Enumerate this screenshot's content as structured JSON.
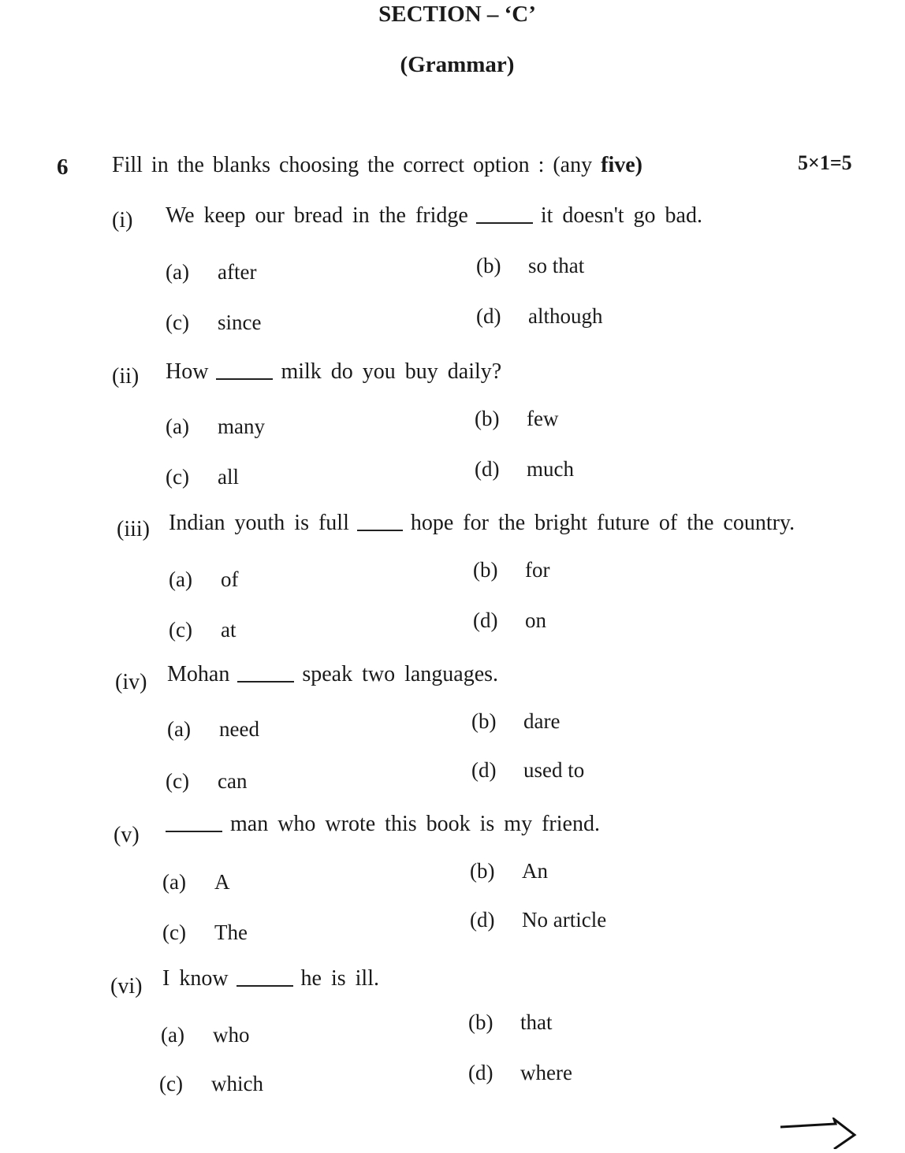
{
  "section": {
    "title": "SECTION – ‘C’",
    "subtitle": "(Grammar)"
  },
  "question": {
    "number": "6",
    "instruction": "Fill in the blanks choosing the correct option : (any",
    "instruction_bold": "five)",
    "marks": "5×1=5",
    "items": [
      {
        "label": "(i)",
        "before": "We keep our bread in the fridge",
        "after": "it doesn't go bad.",
        "options": [
          {
            "label": "(a)",
            "text": "after"
          },
          {
            "label": "(b)",
            "text": "so that"
          },
          {
            "label": "(c)",
            "text": "since"
          },
          {
            "label": "(d)",
            "text": "although"
          }
        ]
      },
      {
        "label": "(ii)",
        "before": "How",
        "after": "milk do you buy daily?",
        "options": [
          {
            "label": "(a)",
            "text": "many"
          },
          {
            "label": "(b)",
            "text": "few"
          },
          {
            "label": "(c)",
            "text": "all"
          },
          {
            "label": "(d)",
            "text": "much"
          }
        ]
      },
      {
        "label": "(iii)",
        "before": "Indian youth is full",
        "after": "hope for the bright future of the country.",
        "options": [
          {
            "label": "(a)",
            "text": "of"
          },
          {
            "label": "(b)",
            "text": "for"
          },
          {
            "label": "(c)",
            "text": "at"
          },
          {
            "label": "(d)",
            "text": "on"
          }
        ]
      },
      {
        "label": "(iv)",
        "before": "Mohan",
        "after": "speak two languages.",
        "options": [
          {
            "label": "(a)",
            "text": "need"
          },
          {
            "label": "(b)",
            "text": "dare"
          },
          {
            "label": "(c)",
            "text": "can"
          },
          {
            "label": "(d)",
            "text": "used to"
          }
        ]
      },
      {
        "label": "(v)",
        "before": "",
        "after": "man who wrote this book is my friend.",
        "options": [
          {
            "label": "(a)",
            "text": "A"
          },
          {
            "label": "(b)",
            "text": "An"
          },
          {
            "label": "(c)",
            "text": "The"
          },
          {
            "label": "(d)",
            "text": "No article"
          }
        ]
      },
      {
        "label": "(vi)",
        "before": "I know",
        "after": "he is ill.",
        "options": [
          {
            "label": "(a)",
            "text": "who"
          },
          {
            "label": "(b)",
            "text": "that"
          },
          {
            "label": "(c)",
            "text": "which"
          },
          {
            "label": "(d)",
            "text": "where"
          }
        ]
      }
    ]
  },
  "footer": {
    "continue_icon": "right-arrow-icon"
  }
}
